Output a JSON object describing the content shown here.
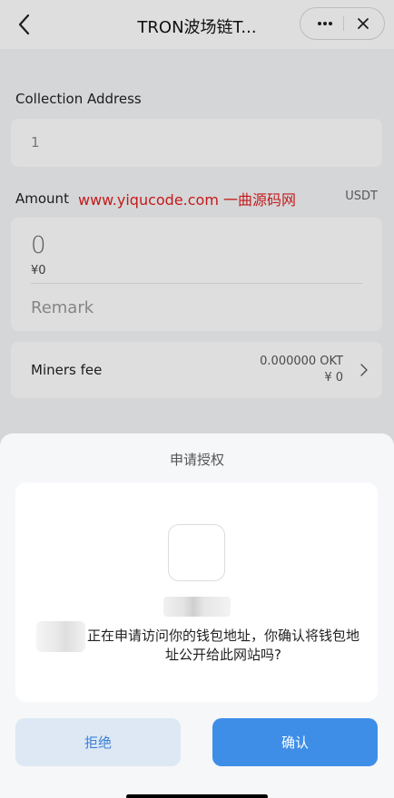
{
  "header": {
    "title": "TRON波场链T...",
    "back_icon": "chevron-left-icon",
    "more_icon": "more-dots-icon",
    "close_icon": "close-icon"
  },
  "form": {
    "address_label": "Collection Address",
    "address_value": "1",
    "amount_label": "Amount",
    "unit": "USDT",
    "amount_value": "0",
    "amount_fiat": "¥0",
    "remark_placeholder": "Remark",
    "miners_fee_label": "Miners fee",
    "fee_okt": "0.000000 OKT",
    "fee_cny": "¥ 0"
  },
  "watermark": "www.yiqucode.com  一曲源码网",
  "auth_sheet": {
    "title": "申请授权",
    "message": "正在申请访问你的钱包地址，你确认将钱包地址公开给此网站吗?",
    "reject_label": "拒绝",
    "confirm_label": "确认"
  },
  "colors": {
    "accent": "#3e8ee8",
    "watermark": "#e02020",
    "reject_bg": "#dde8f4"
  }
}
